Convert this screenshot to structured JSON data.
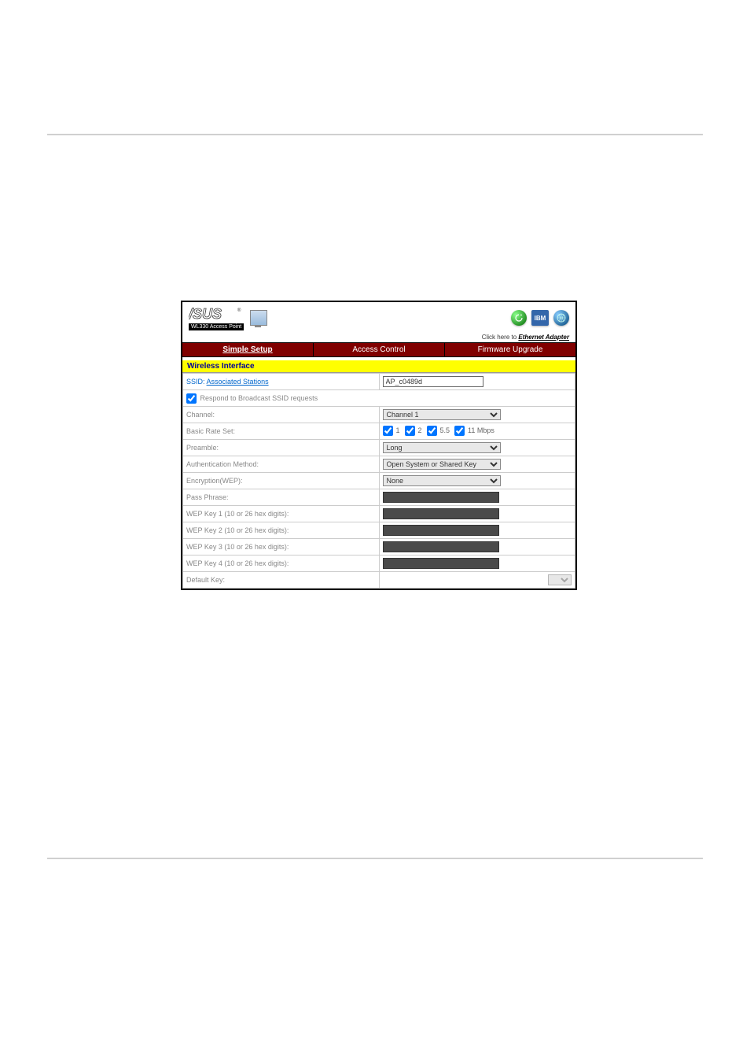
{
  "header": {
    "logo_subtext": "WL330 Access Point",
    "click_prefix": "Click here to ",
    "click_link": "Ethernet Adapter"
  },
  "tabs": {
    "simple": "Simple Setup",
    "access": "Access Control",
    "firmware": "Firmware Upgrade"
  },
  "section": {
    "wireless": "Wireless Interface"
  },
  "rows": {
    "ssid_label": "SSID:",
    "ssid_link": "Associated Stations",
    "ssid_value": "AP_c0489d",
    "respond": "Respond to Broadcast SSID requests",
    "channel_label": "Channel:",
    "channel_value": "Channel 1",
    "basic_rate_label": "Basic Rate Set:",
    "rate_1": "1",
    "rate_2": "2",
    "rate_55": "5.5",
    "rate_11": "11 Mbps",
    "preamble_label": "Preamble:",
    "preamble_value": "Long",
    "auth_label": "Authentication Method:",
    "auth_value": "Open System or Shared Key",
    "enc_label": "Encryption(WEP):",
    "enc_value": "None",
    "pass_label": "Pass Phrase:",
    "wep1_label": "WEP Key 1 (10 or 26 hex digits):",
    "wep2_label": "WEP Key 2 (10 or 26 hex digits):",
    "wep3_label": "WEP Key 3 (10 or 26 hex digits):",
    "wep4_label": "WEP Key 4 (10 or 26 hex digits):",
    "default_key_label": "Default Key:"
  }
}
